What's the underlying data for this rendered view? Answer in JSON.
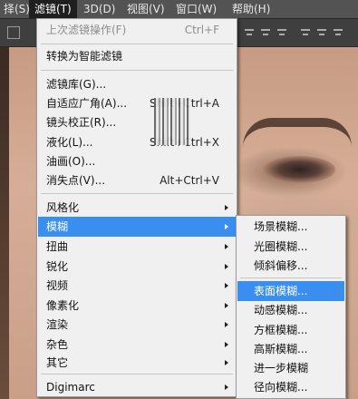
{
  "menubar": {
    "items": [
      "择(S)",
      "滤镜(T)",
      "3D(D)",
      "视图(V)",
      "窗口(W)",
      "帮助(H)"
    ],
    "active": "滤镜(T)"
  },
  "filter_menu": {
    "last_filter": "上次滤镜操作(F)",
    "last_filter_shortcut": "Ctrl+F",
    "convert_smart": "转换为智能滤镜",
    "gallery": "滤镜库(G)...",
    "adaptive_wide": "自适应广角(A)...",
    "adaptive_wide_shortcut": "Shift+Ctrl+A",
    "lens_correction": "镜头校正(R)...",
    "liquify": "液化(L)...",
    "liquify_shortcut": "Shift+Ctrl+X",
    "oil_paint": "油画(O)...",
    "vanishing_point": "消失点(V)...",
    "vanishing_point_shortcut": "Alt+Ctrl+V",
    "stylize": "风格化",
    "blur": "模糊",
    "distort": "扭曲",
    "sharpen": "锐化",
    "video": "视频",
    "pixelate": "像素化",
    "render": "渲染",
    "noise": "杂色",
    "other": "其它",
    "digimarc": "Digimarc"
  },
  "blur_submenu": {
    "field_blur": "场景模糊...",
    "iris_blur": "光圈模糊...",
    "tilt_shift": "倾斜偏移...",
    "surface_blur": "表面模糊...",
    "motion_blur": "动感模糊...",
    "box_blur": "方框模糊...",
    "gaussian_blur": "高斯模糊...",
    "blur_more": "进一步模糊",
    "radial_blur": "径向模糊..."
  },
  "colors": {
    "highlight": "#3a8ef0",
    "menubar": "#535353",
    "menu_bg": "#f0f0f0"
  }
}
